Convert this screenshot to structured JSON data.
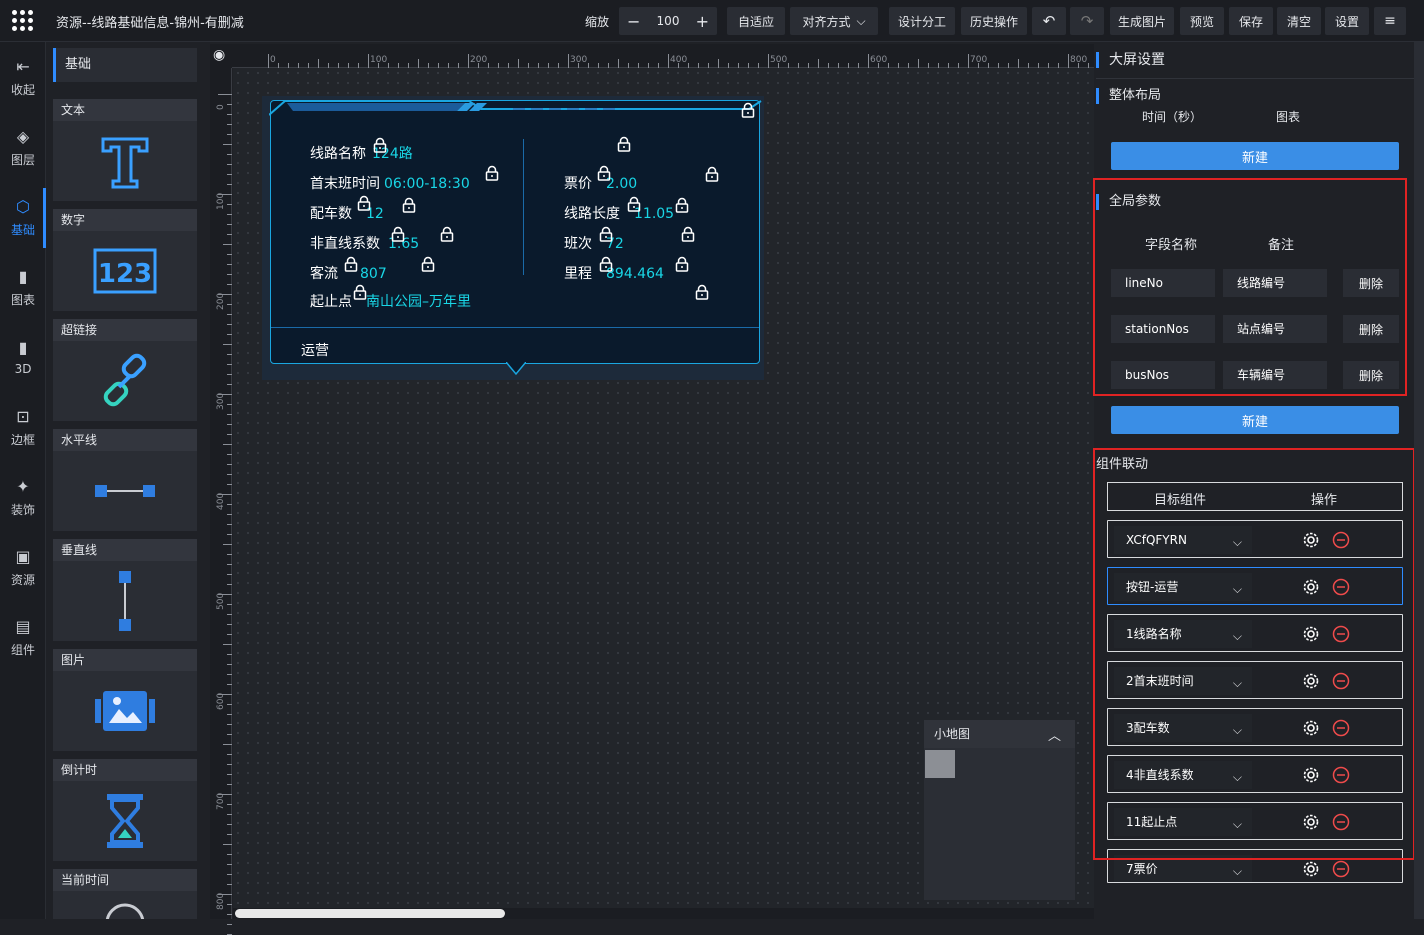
{
  "header": {
    "title": "资源--线路基础信息-锦州-有删减",
    "zoom_label": "缩放",
    "zoom_value": "100",
    "buttons": [
      "自适应",
      "对齐方式",
      "设计分工",
      "历史操作",
      "生成图片",
      "预览",
      "保存",
      "清空",
      "设置"
    ]
  },
  "rail": [
    "收起",
    "图层",
    "基础",
    "图表",
    "3D",
    "边框",
    "装饰",
    "资源",
    "组件"
  ],
  "palette": {
    "header": "基础",
    "items": [
      "文本",
      "数字",
      "超链接",
      "水平线",
      "垂直线",
      "图片",
      "倒计时",
      "当前时间"
    ]
  },
  "ruler": {
    "top": [
      "0",
      "100",
      "200",
      "300",
      "400",
      "500",
      "600",
      "700",
      "800"
    ],
    "left": [
      "0",
      "100",
      "200",
      "300",
      "400",
      "500",
      "600",
      "700",
      "800"
    ]
  },
  "component": {
    "left_fields": [
      {
        "label": "线路名称",
        "value": "124路"
      },
      {
        "label": "首末班时间",
        "value": "06:00-18:30"
      },
      {
        "label": "配车数",
        "value": "12"
      },
      {
        "label": "非直线系数",
        "value": "1.65"
      },
      {
        "label": "客流",
        "value": "807"
      },
      {
        "label": "起止点",
        "value": "南山公园–万年里"
      }
    ],
    "right_fields": [
      {
        "label": "票价",
        "value": "2.00"
      },
      {
        "label": "线路长度",
        "value": "11.05"
      },
      {
        "label": "班次",
        "value": "72"
      },
      {
        "label": "里程",
        "value": "894.464"
      }
    ],
    "footer": "运营"
  },
  "minimap": {
    "title": "小地图"
  },
  "right": {
    "title": "大屏设置",
    "layout": {
      "title": "整体布局",
      "col1": "时间（秒）",
      "col2": "图表",
      "new": "新建"
    },
    "globals": {
      "title": "全局参数",
      "col1": "字段名称",
      "col2": "备注",
      "rows": [
        {
          "name": "lineNo",
          "note": "线路编号",
          "del": "删除"
        },
        {
          "name": "stationNos",
          "note": "站点编号",
          "del": "删除"
        },
        {
          "name": "busNos",
          "note": "车辆编号",
          "del": "删除"
        }
      ],
      "new": "新建"
    },
    "linkage": {
      "title": "组件联动",
      "col1": "目标组件",
      "col2": "操作",
      "rows": [
        "XCfQFYRN",
        "按钮-运营",
        "1线路名称",
        "2首末班时间",
        "3配车数",
        "4非直线系数",
        "11起止点",
        "7票价"
      ]
    }
  },
  "colors": {
    "accent": "#2f8cff",
    "highlight": "#e02323",
    "value_cyan": "#19d6e6"
  }
}
